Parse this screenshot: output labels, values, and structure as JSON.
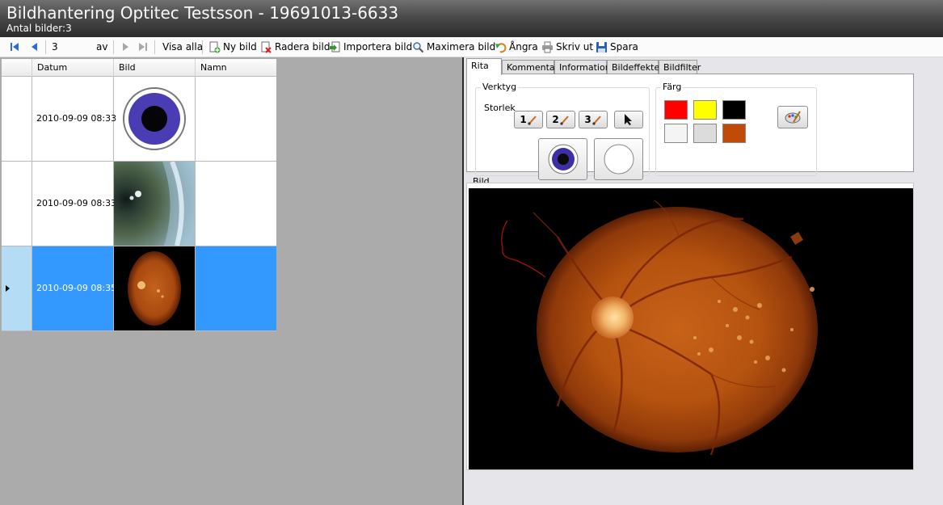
{
  "window": {
    "title": "Bildhantering Optitec Testsson - 19691013-6633",
    "subtitle": "Antal bilder:3"
  },
  "toolbar": {
    "position_value": "3",
    "of_label": "av",
    "show_all": "Visa alla",
    "new_image": "Ny bild",
    "delete_image": "Radera bild",
    "import_image": "Importera bild",
    "maximize_image": "Maximera bild",
    "undo": "Ångra",
    "print": "Skriv ut",
    "save": "Spara"
  },
  "grid": {
    "columns": [
      "Datum",
      "Bild",
      "Namn"
    ],
    "rows": [
      {
        "date": "2010-09-09 08:33",
        "image": "eye-drawing-thumbnail",
        "name": "",
        "selected": false
      },
      {
        "date": "2010-09-09 08:33",
        "image": "iris-photo-thumbnail",
        "name": "",
        "selected": false
      },
      {
        "date": "2010-09-09 08:35",
        "image": "fundus-photo-thumbnail",
        "name": "",
        "selected": true
      }
    ]
  },
  "tabs": [
    "Rita",
    "Kommentar",
    "Information",
    "Bildeffekter",
    "Bildfilter"
  ],
  "draw": {
    "tools_label": "Verktyg",
    "size_label": "Storlek",
    "sizes": [
      "1",
      "2",
      "3"
    ],
    "color_label": "Färg",
    "colors": [
      "#ff0000",
      "#ffff00",
      "#000000",
      "#f4f4f4",
      "#dcdcdc",
      "#c04a08"
    ]
  },
  "image_panel": {
    "label": "Bild"
  },
  "icons": {
    "first": "first-record-icon",
    "prev": "previous-record-icon",
    "next": "next-record-icon",
    "last": "last-record-icon",
    "new": "new-image-icon",
    "delete": "delete-image-icon",
    "import": "import-image-icon",
    "maximize": "magnifier-icon",
    "undo": "undo-icon",
    "print": "printer-icon",
    "save": "floppy-disk-icon",
    "pointer": "cursor-arrow-icon",
    "brush": "brush-icon",
    "palette": "palette-icon"
  }
}
